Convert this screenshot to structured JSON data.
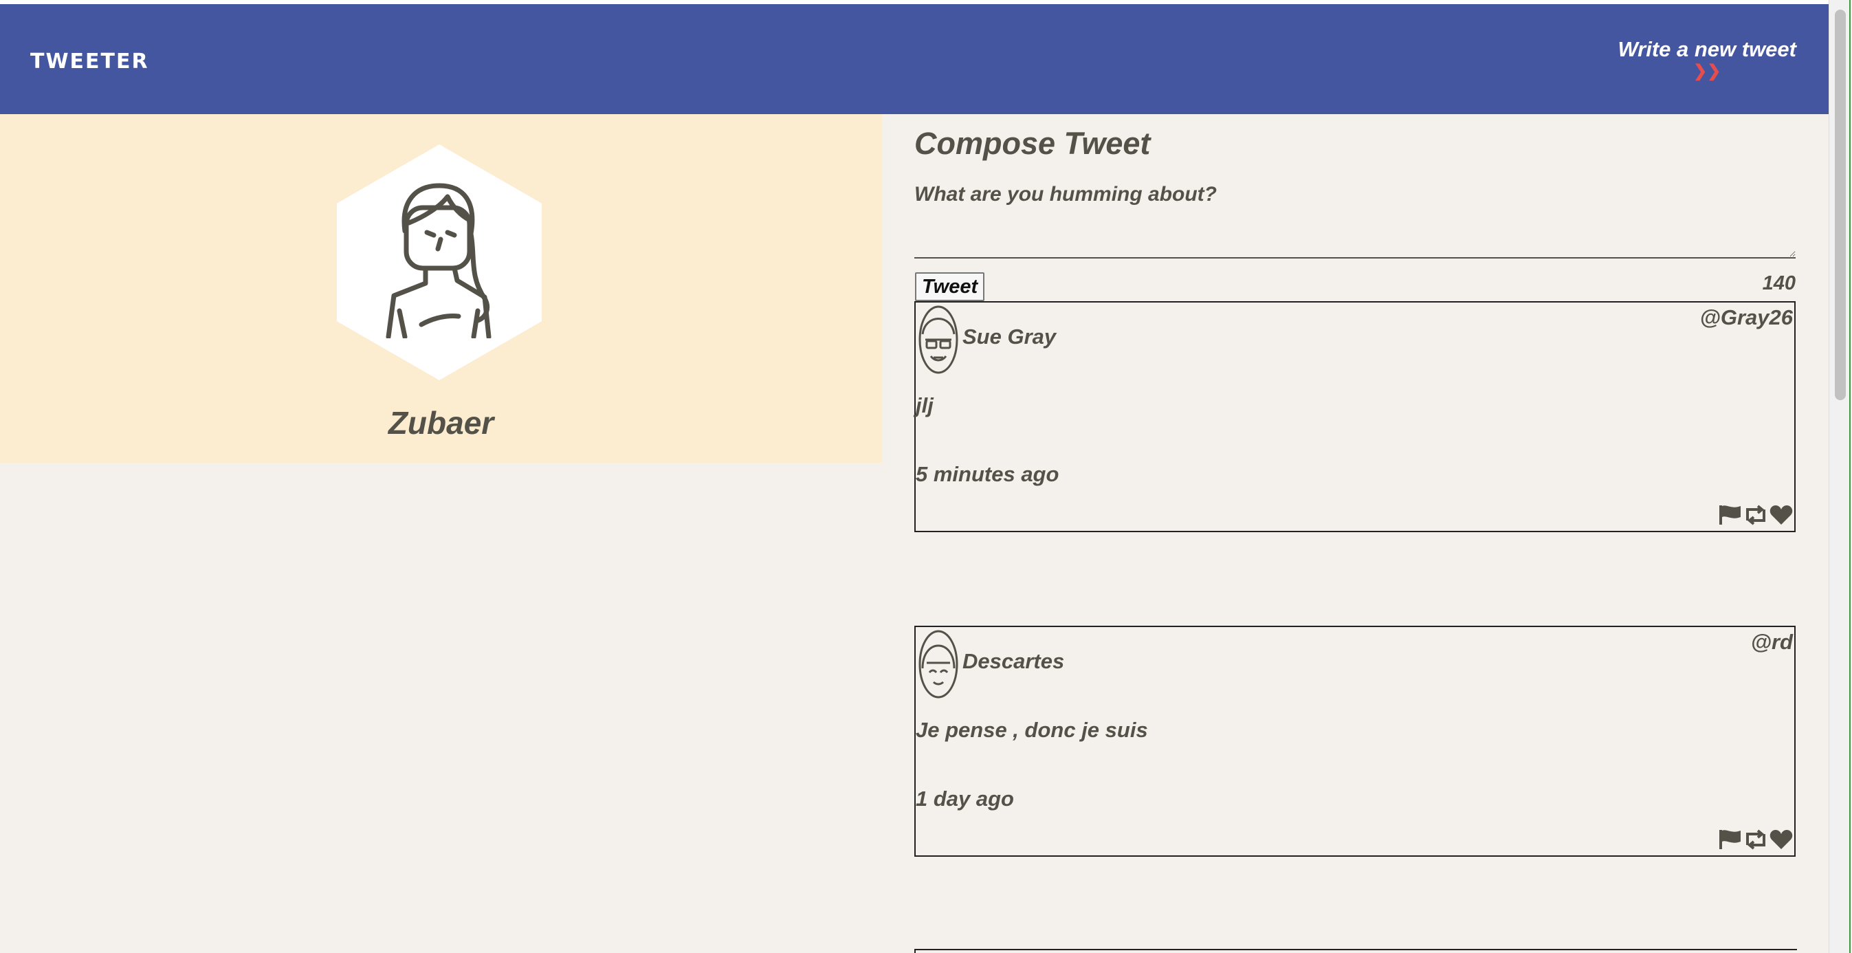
{
  "navbar": {
    "brand": "TWEETER",
    "write_label": "Write a new tweet",
    "write_icon": "double-chevron-down-icon",
    "bg_color": "#4556a0",
    "chevron_color": "#e64d4d"
  },
  "profile": {
    "name": "Zubaer",
    "bg_color": "#fcecd0"
  },
  "compose": {
    "title": "Compose Tweet",
    "placeholder": "What are you humming about?",
    "button_label": "Tweet",
    "counter": "140"
  },
  "tweets": [
    {
      "name": "Sue Gray",
      "handle": "@Gray26",
      "body": "jlj",
      "time": "5 minutes ago"
    },
    {
      "name": "Descartes",
      "handle": "@rd",
      "body": "Je pense , donc je suis",
      "time": "1 day ago"
    }
  ],
  "tweet_action_icons": [
    "flag-icon",
    "retweet-icon",
    "heart-icon"
  ]
}
